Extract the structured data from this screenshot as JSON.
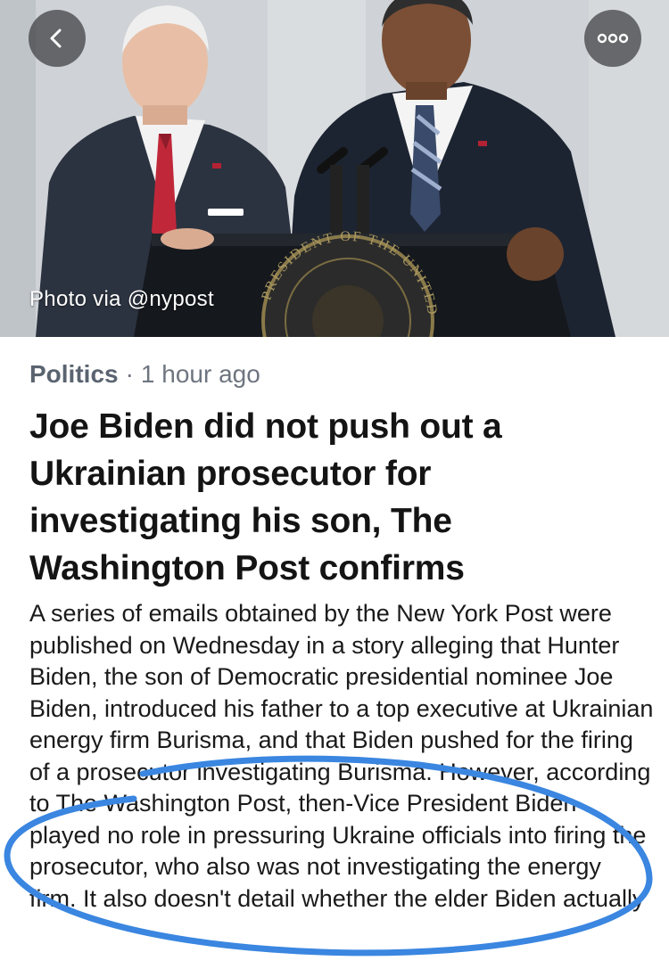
{
  "hero": {
    "photo_credit": "Photo via @nypost",
    "seal_text": "PRESIDENT OF THE UNITED"
  },
  "nav": {
    "back_icon": "chevron-left-icon",
    "more_icon": "more-dots-icon"
  },
  "article": {
    "category": "Politics",
    "separator": "·",
    "time_ago": "1 hour ago",
    "headline": "Joe Biden did not push out a Ukrainian prosecutor for investigating his son, The Washington Post confirms",
    "body": "A series of emails obtained by the New York Post were published on Wednesday in a story alleging that Hunter Biden, the son of Democratic presidential nominee Joe Biden, introduced his father to a top executive at Ukrainian energy firm Burisma, and that Biden pushed for the firing of a prosecutor investigating Burisma. However, according to The Washington Post, then-Vice President Biden played no role in pressuring Ukraine officials into firing the prosecutor, who also was not investigating the energy firm. It also doesn't detail whether the elder Biden actually"
  },
  "colors": {
    "annotation_ring": "#3a86e0",
    "category_text": "#5a6470",
    "headline_text": "#141414"
  }
}
